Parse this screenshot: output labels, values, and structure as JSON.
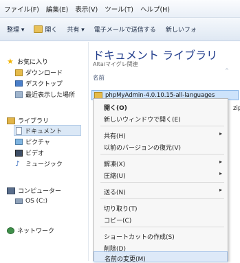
{
  "menubar": {
    "file": "ファイル(F)",
    "edit": "編集(E)",
    "view": "表示(V)",
    "tools": "ツール(T)",
    "help": "ヘルプ(H)"
  },
  "toolbar": {
    "organize": "整理 ▾",
    "open": "開く",
    "share": "共有 ▾",
    "email": "電子メールで送信する",
    "newfolder": "新しいフォ"
  },
  "nav": {
    "favorites": "お気に入り",
    "downloads": "ダウンロード",
    "desktop": "デスクトップ",
    "recent": "最近表示した場所",
    "libraries": "ライブラリ",
    "documents": "ドキュメント",
    "pictures": "ピクチャ",
    "videos": "ビデオ",
    "music": "ミュージック",
    "computer": "コンピューター",
    "osdrive": "OS (C:)",
    "network": "ネットワーク"
  },
  "content": {
    "title": "ドキュメント ライブラリ",
    "subtitle": "Altaiマイグレ関連",
    "column_name": "名前",
    "selected_file": "phpMyAdmin-4.0.10.15-all-languages",
    "partial_text": "zip"
  },
  "context_menu": {
    "open": "開く(O)",
    "open_new_window": "新しいウィンドウで開く(E)",
    "share": "共有(H)",
    "restore_versions": "以前のバージョンの復元(V)",
    "extract": "解凍(X)",
    "compress": "圧縮(U)",
    "send_to": "送る(N)",
    "cut": "切り取り(T)",
    "copy": "コピー(C)",
    "create_shortcut": "ショートカットの作成(S)",
    "delete": "削除(D)",
    "rename": "名前の変更(M)"
  },
  "colors": {
    "title_blue": "#1e3a8a",
    "selection_blue": "#cde3fb",
    "menu_bg": "#f7f7f7"
  }
}
